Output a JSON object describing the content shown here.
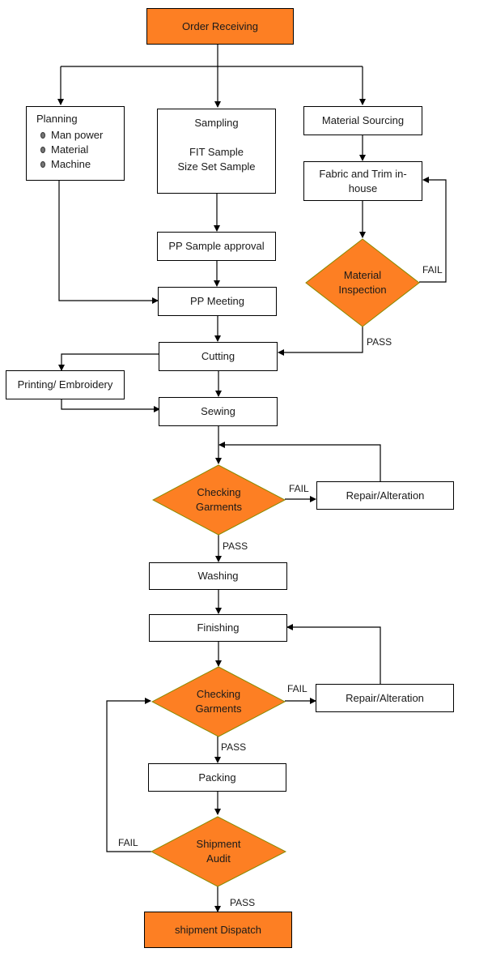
{
  "colors": {
    "terminal_fill": "#fd7f23",
    "decision_fill": "#fd7f23",
    "process_fill": "#ffffff",
    "line": "#000000"
  },
  "nodes": {
    "order_receiving": "Order Receiving",
    "planning": {
      "title": "Planning",
      "items": [
        "Man power",
        "Material",
        "Machine"
      ]
    },
    "sampling": {
      "title": "Sampling",
      "line1": "FIT Sample",
      "line2": "Size Set Sample"
    },
    "material_sourcing": "Material Sourcing",
    "fabric_trim": {
      "line1": "Fabric and Trim in-",
      "line2": "house"
    },
    "material_inspection": {
      "line1": "Material",
      "line2": "Inspection"
    },
    "pp_sample_approval": "PP Sample approval",
    "pp_meeting": "PP Meeting",
    "cutting": "Cutting",
    "printing_embroidery": "Printing/ Embroidery",
    "sewing": "Sewing",
    "checking_garments_1": {
      "line1": "Checking",
      "line2": "Garments"
    },
    "repair_alteration_1": "Repair/Alteration",
    "washing": "Washing",
    "finishing": "Finishing",
    "checking_garments_2": {
      "line1": "Checking",
      "line2": "Garments"
    },
    "repair_alteration_2": "Repair/Alteration",
    "packing": "Packing",
    "shipment_audit": {
      "line1": "Shipment",
      "line2": "Audit"
    },
    "shipment_dispatch": "shipment Dispatch"
  },
  "edge_labels": {
    "material_inspection_fail": "FAIL",
    "material_inspection_pass": "PASS",
    "checking_1_fail": "FAIL",
    "checking_1_pass": "PASS",
    "checking_2_fail": "FAIL",
    "checking_2_pass": "PASS",
    "audit_fail": "FAIL",
    "audit_pass": "PASS"
  }
}
